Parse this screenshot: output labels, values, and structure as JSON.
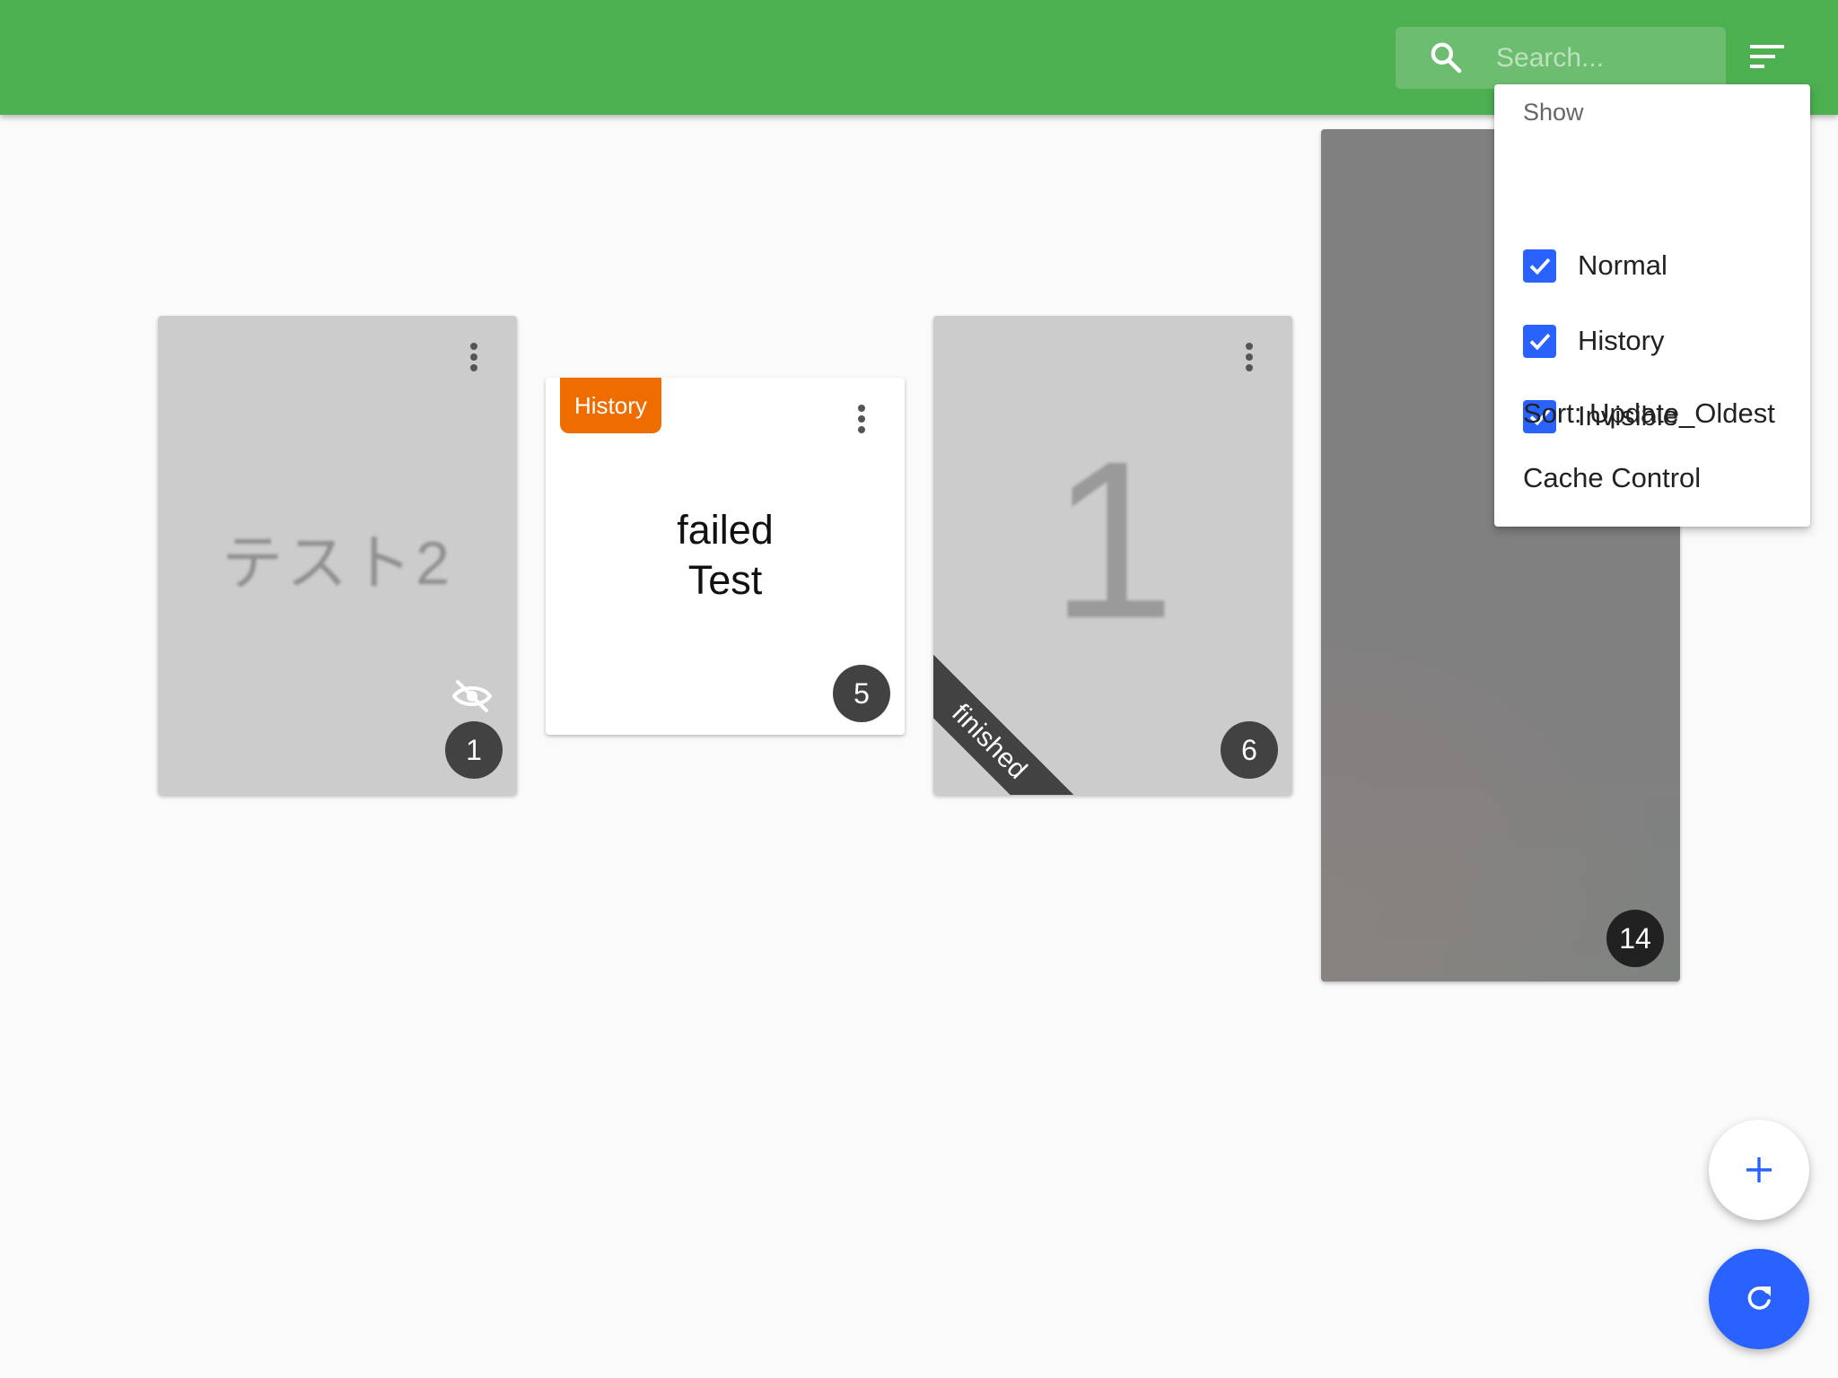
{
  "search": {
    "placeholder": "Search..."
  },
  "cards": [
    {
      "title": "テスト2",
      "count": "1",
      "hidden_icon": "eye-off-icon"
    },
    {
      "label": "History",
      "title_line1": "failed",
      "title_line2": "Test",
      "count": "5"
    },
    {
      "title": "1",
      "ribbon": "finished",
      "count": "6"
    },
    {
      "count": "14"
    }
  ],
  "filter_menu": {
    "header": "Show",
    "options": [
      {
        "label": "Normal",
        "checked": true
      },
      {
        "label": "History",
        "checked": true
      },
      {
        "label": "Invisible",
        "checked": true
      }
    ],
    "sort_label": "Sort: Update_Oldest",
    "cache_label": "Cache Control"
  },
  "colors": {
    "appbar": "#4caf50",
    "accent": "#2962ff",
    "history_chip": "#ef6c00"
  },
  "icons": {
    "search": "search-icon",
    "filter": "filter-list-icon",
    "more": "more-vert-icon",
    "add": "plus-icon",
    "refresh": "refresh-icon",
    "check": "check-icon"
  }
}
